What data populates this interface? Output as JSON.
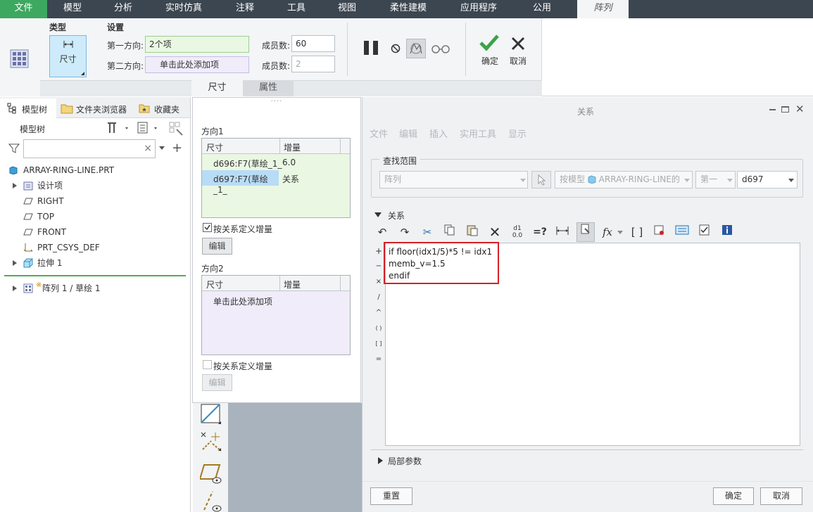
{
  "menu": {
    "file": "文件",
    "items": [
      "模型",
      "分析",
      "实时仿真",
      "注释",
      "工具",
      "视图",
      "柔性建模",
      "应用程序",
      "公用"
    ],
    "active_tab": "阵列"
  },
  "ribbon": {
    "type_group": "类型",
    "type_button": "尺寸",
    "settings_group": "设置",
    "dir1_label": "第一方向:",
    "dir1_value": "2个项",
    "dir2_label": "第二方向:",
    "dir2_value": "单击此处添加项",
    "members_label1": "成员数:",
    "members_value1": "60",
    "members_label2": "成员数:",
    "members_value2": "2",
    "ok_label": "确定",
    "cancel_label": "取消",
    "subtabs": [
      "尺寸",
      "属性"
    ]
  },
  "left_tabs": {
    "model_tree": "模型树",
    "folder_browser": "文件夹浏览器",
    "favorites": "收藏夹"
  },
  "model_tree": {
    "title": "模型树",
    "root": "ARRAY-RING-LINE.PRT",
    "items": [
      "设计项",
      "RIGHT",
      "TOP",
      "FRONT",
      "PRT_CSYS_DEF",
      "拉伸 1"
    ],
    "pattern_item": "阵列 1 / 草绘 1"
  },
  "dim_panel": {
    "dir1_title": "方向1",
    "col_dim": "尺寸",
    "col_inc": "增量",
    "rows": [
      {
        "dim": "d696:F7(草绘_1_",
        "inc": "6.0"
      },
      {
        "dim": "d697:F7(草绘_1_",
        "inc": "关系"
      }
    ],
    "checkbox1": "按关系定义增量",
    "edit1": "编辑",
    "dir2_title": "方向2",
    "dir2_placeholder": "单击此处添加项",
    "checkbox2": "按关系定义增量",
    "edit2": "编辑"
  },
  "dialog": {
    "title": "关系",
    "menu": [
      "文件",
      "编辑",
      "插入",
      "实用工具",
      "显示"
    ],
    "search_scope": "查找范围",
    "scope_combo": "阵列",
    "by_model": "按模型",
    "model_name": "ARRAY-RING-LINE的",
    "first_combo": "第一",
    "param_combo": "d697",
    "relations_section": "关系",
    "code_lines": [
      "if floor(idx1/5)*5 != idx1",
      "memb_v=1.5",
      "endif"
    ],
    "operators": [
      "+",
      "−",
      "×",
      "/",
      "^",
      "( )",
      "[ ]",
      "="
    ],
    "local_params": "局部参数",
    "reset": "重置",
    "ok": "确定",
    "cancel": "取消"
  },
  "colors": {
    "menubar": "#3c4650",
    "file_tab": "#3da85f",
    "highlight_row": "#b8dcf5",
    "green_panel": "#eaf7e3",
    "purple_panel": "#f0ecfa",
    "red_box": "#d32027",
    "graphics_bg": "#a8b3bd"
  }
}
